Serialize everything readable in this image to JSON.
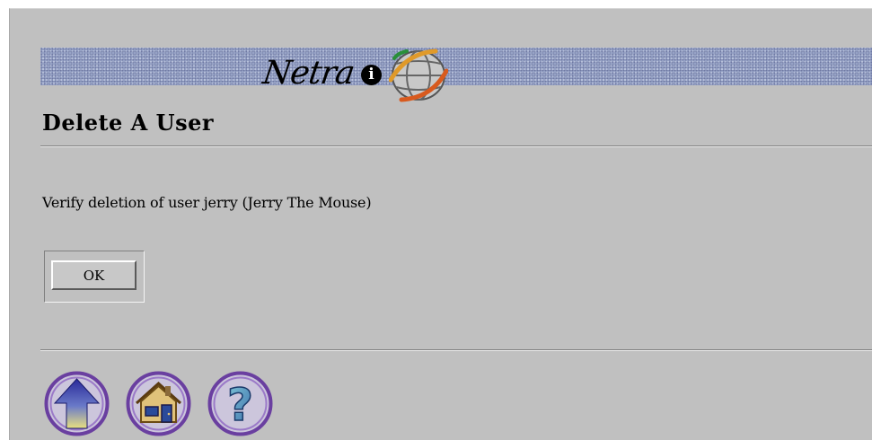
{
  "banner": {
    "logo_text": "Netra",
    "info_glyph": "i",
    "icons": [
      "info-icon",
      "globe-icon"
    ]
  },
  "page": {
    "title": "Delete A User",
    "message": "Verify deletion of user jerry (Jerry The Mouse)"
  },
  "form": {
    "ok_label": "OK"
  },
  "nav": {
    "icons": [
      "up-arrow-icon",
      "home-icon",
      "help-icon"
    ],
    "help_glyph": "?"
  },
  "colors": {
    "background": "#c0c0c0",
    "banner": "#9aa6c8",
    "nav_ring": "#6a3fa0"
  }
}
